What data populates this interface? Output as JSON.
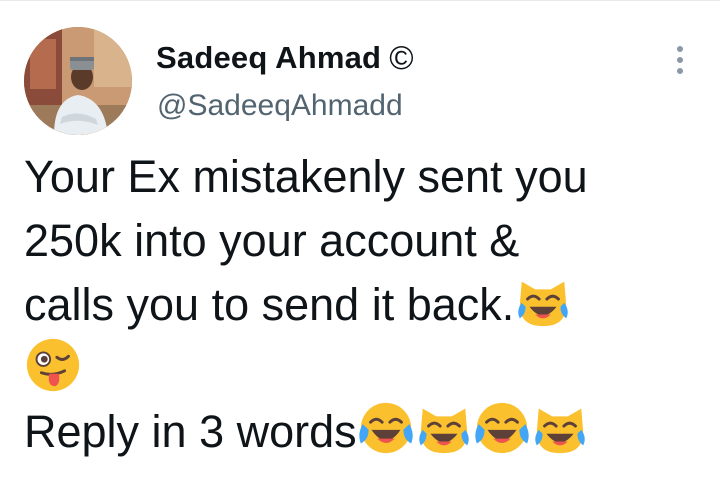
{
  "author": {
    "display_name": "Sadeeq Ahmad",
    "badge": "©",
    "handle": "@SadeeqAhmadd",
    "avatar_icon": "profile-photo"
  },
  "menu": {
    "icon": "more-options-icon"
  },
  "tweet": {
    "line1": "Your Ex mistakenly sent you",
    "line2": "250k into your account &",
    "line3": "calls you to send it back.",
    "line5": "Reply in 3 words"
  },
  "emojis": {
    "cat_tears": "cat-face-with-tears-of-joy-icon",
    "face_tears": "face-with-tears-of-joy-icon",
    "wink_tongue": "winking-face-with-tongue-icon"
  },
  "colors": {
    "text": "#0f1419",
    "secondary_text": "#536471",
    "divider": "#e7e9ea",
    "emoji_yellow": "#fbc02d"
  }
}
